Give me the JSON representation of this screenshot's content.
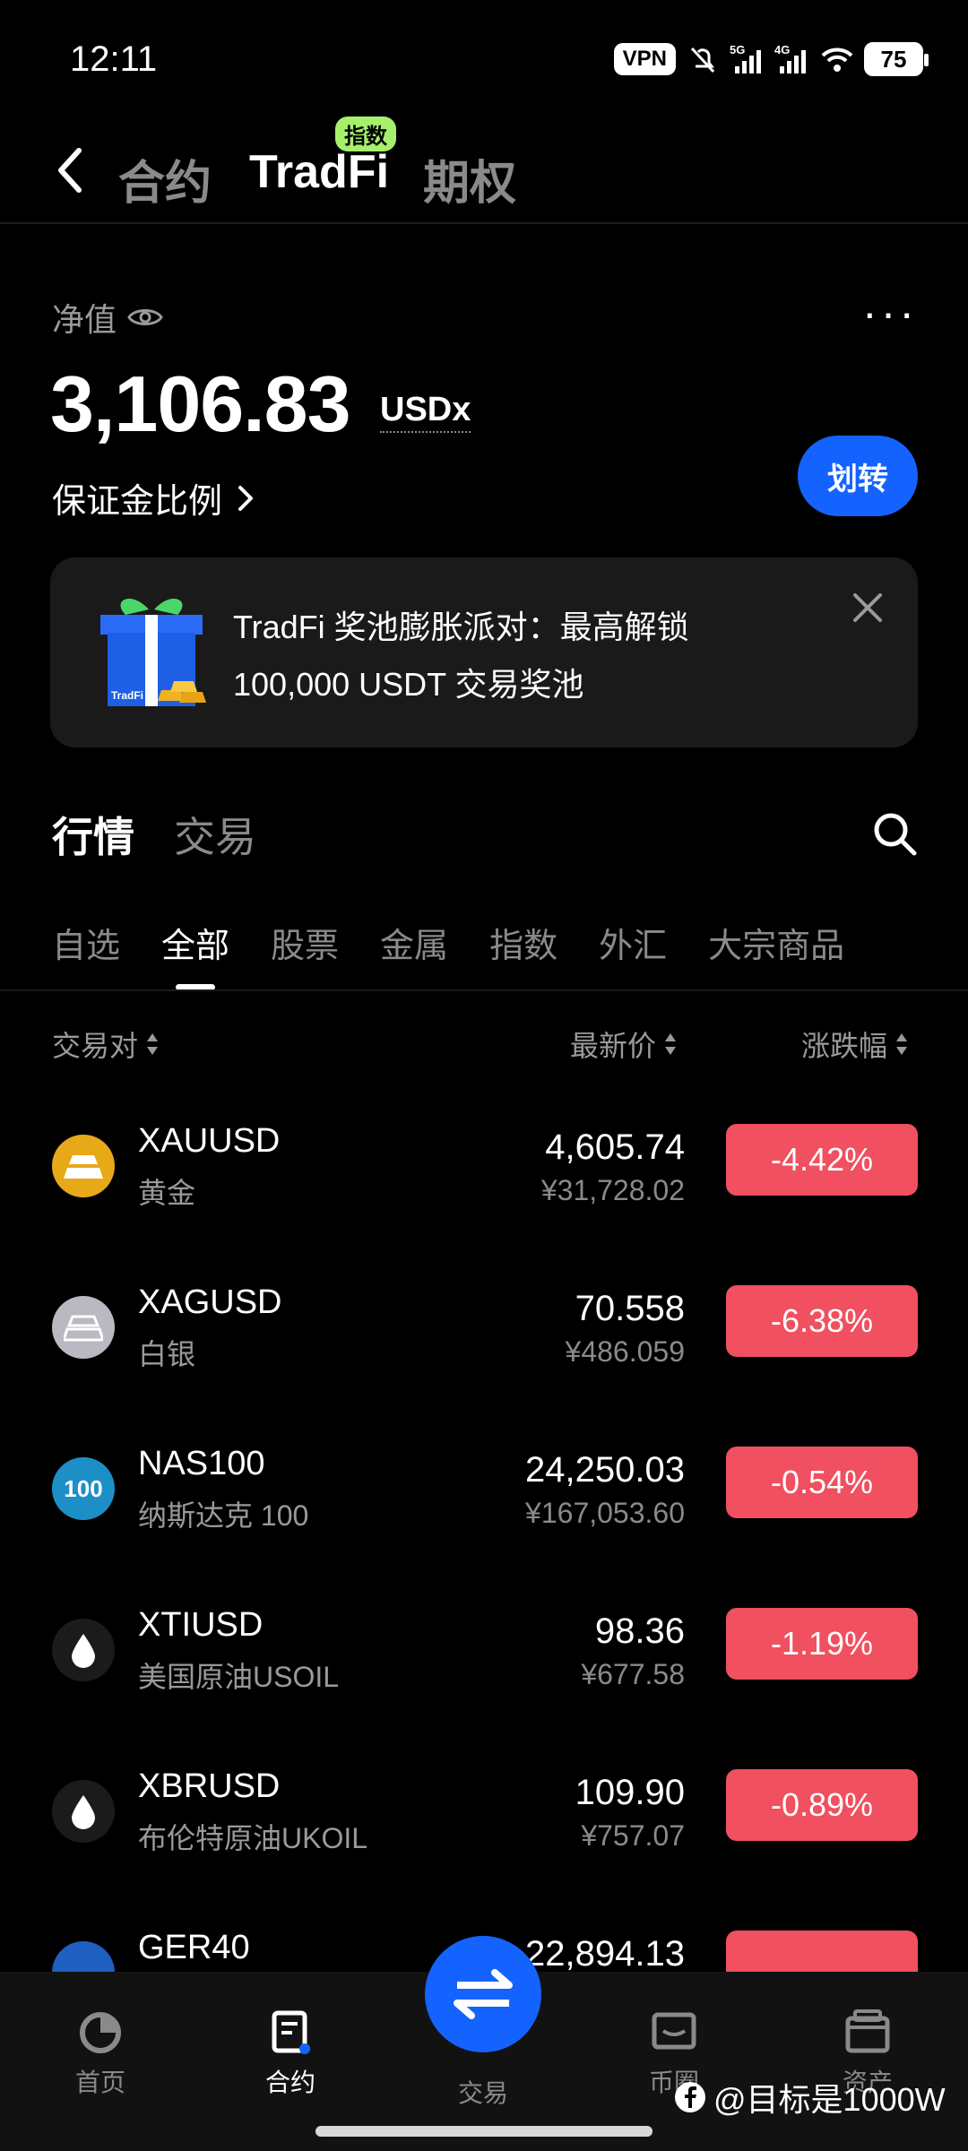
{
  "status_bar": {
    "time": "12:11",
    "vpn": "VPN",
    "battery": "75"
  },
  "header": {
    "tabs": [
      {
        "label": "合约",
        "active": false
      },
      {
        "label": "TradFi",
        "active": true,
        "badge": "指数"
      },
      {
        "label": "期权",
        "active": false
      }
    ]
  },
  "account": {
    "net_value_label": "净值",
    "net_value": "3,106.83",
    "unit": "USDx",
    "margin_ratio_label": "保证金比例",
    "transfer_label": "划转"
  },
  "banner": {
    "line1": "TradFi 奖池膨胀派对：最高解锁",
    "line2": "100,000 USDT 交易奖池",
    "gift_text": "TradFi"
  },
  "section_tabs": [
    {
      "label": "行情",
      "active": true
    },
    {
      "label": "交易",
      "active": false
    }
  ],
  "categories": [
    {
      "label": "自选",
      "active": false
    },
    {
      "label": "全部",
      "active": true
    },
    {
      "label": "股票",
      "active": false
    },
    {
      "label": "金属",
      "active": false
    },
    {
      "label": "指数",
      "active": false
    },
    {
      "label": "外汇",
      "active": false
    },
    {
      "label": "大宗商品",
      "active": false
    }
  ],
  "columns": {
    "pair": "交易对",
    "price": "最新价",
    "change": "涨跌幅"
  },
  "rows": [
    {
      "symbol": "XAUUSD",
      "name": "黄金",
      "price": "4,605.74",
      "cny": "¥31,728.02",
      "change": "-4.42%",
      "icon": "gold-icon",
      "icon_bg": "#e8a918"
    },
    {
      "symbol": "XAGUSD",
      "name": "白银",
      "price": "70.558",
      "cny": "¥486.059",
      "change": "-6.38%",
      "icon": "silver-icon",
      "icon_bg": "#b9b9c2"
    },
    {
      "symbol": "NAS100",
      "name": "纳斯达克 100",
      "price": "24,250.03",
      "cny": "¥167,053.60",
      "change": "-0.54%",
      "icon": "nasdaq-icon",
      "icon_bg": "#1d8fc7",
      "icon_text": "100"
    },
    {
      "symbol": "XTIUSD",
      "name": "美国原油USOIL",
      "price": "98.36",
      "cny": "¥677.58",
      "change": "-1.19%",
      "icon": "oil-drop-icon",
      "icon_bg": "#1b1b1b"
    },
    {
      "symbol": "XBRUSD",
      "name": "布伦特原油UKOIL",
      "price": "109.90",
      "cny": "¥757.07",
      "change": "-0.89%",
      "icon": "oil-drop-icon",
      "icon_bg": "#1b1b1b"
    },
    {
      "symbol": "GER40",
      "name": "",
      "price": "22,894.13",
      "cny": "",
      "change": "",
      "icon": "germany-flag-icon",
      "icon_bg": "#1f5fbf"
    }
  ],
  "bottom_nav": [
    {
      "label": "首页",
      "active": false,
      "icon": "home-icon"
    },
    {
      "label": "合约",
      "active": true,
      "icon": "contract-icon"
    },
    {
      "label": "交易",
      "active": false,
      "icon": "swap-icon"
    },
    {
      "label": "币圈",
      "active": false,
      "icon": "chat-icon"
    },
    {
      "label": "资产",
      "active": false,
      "icon": "wallet-icon"
    }
  ],
  "watermark": "@目标是1000W",
  "colors": {
    "accent": "#1463ff",
    "down": "#f0505f",
    "badge": "#a6f06c"
  }
}
